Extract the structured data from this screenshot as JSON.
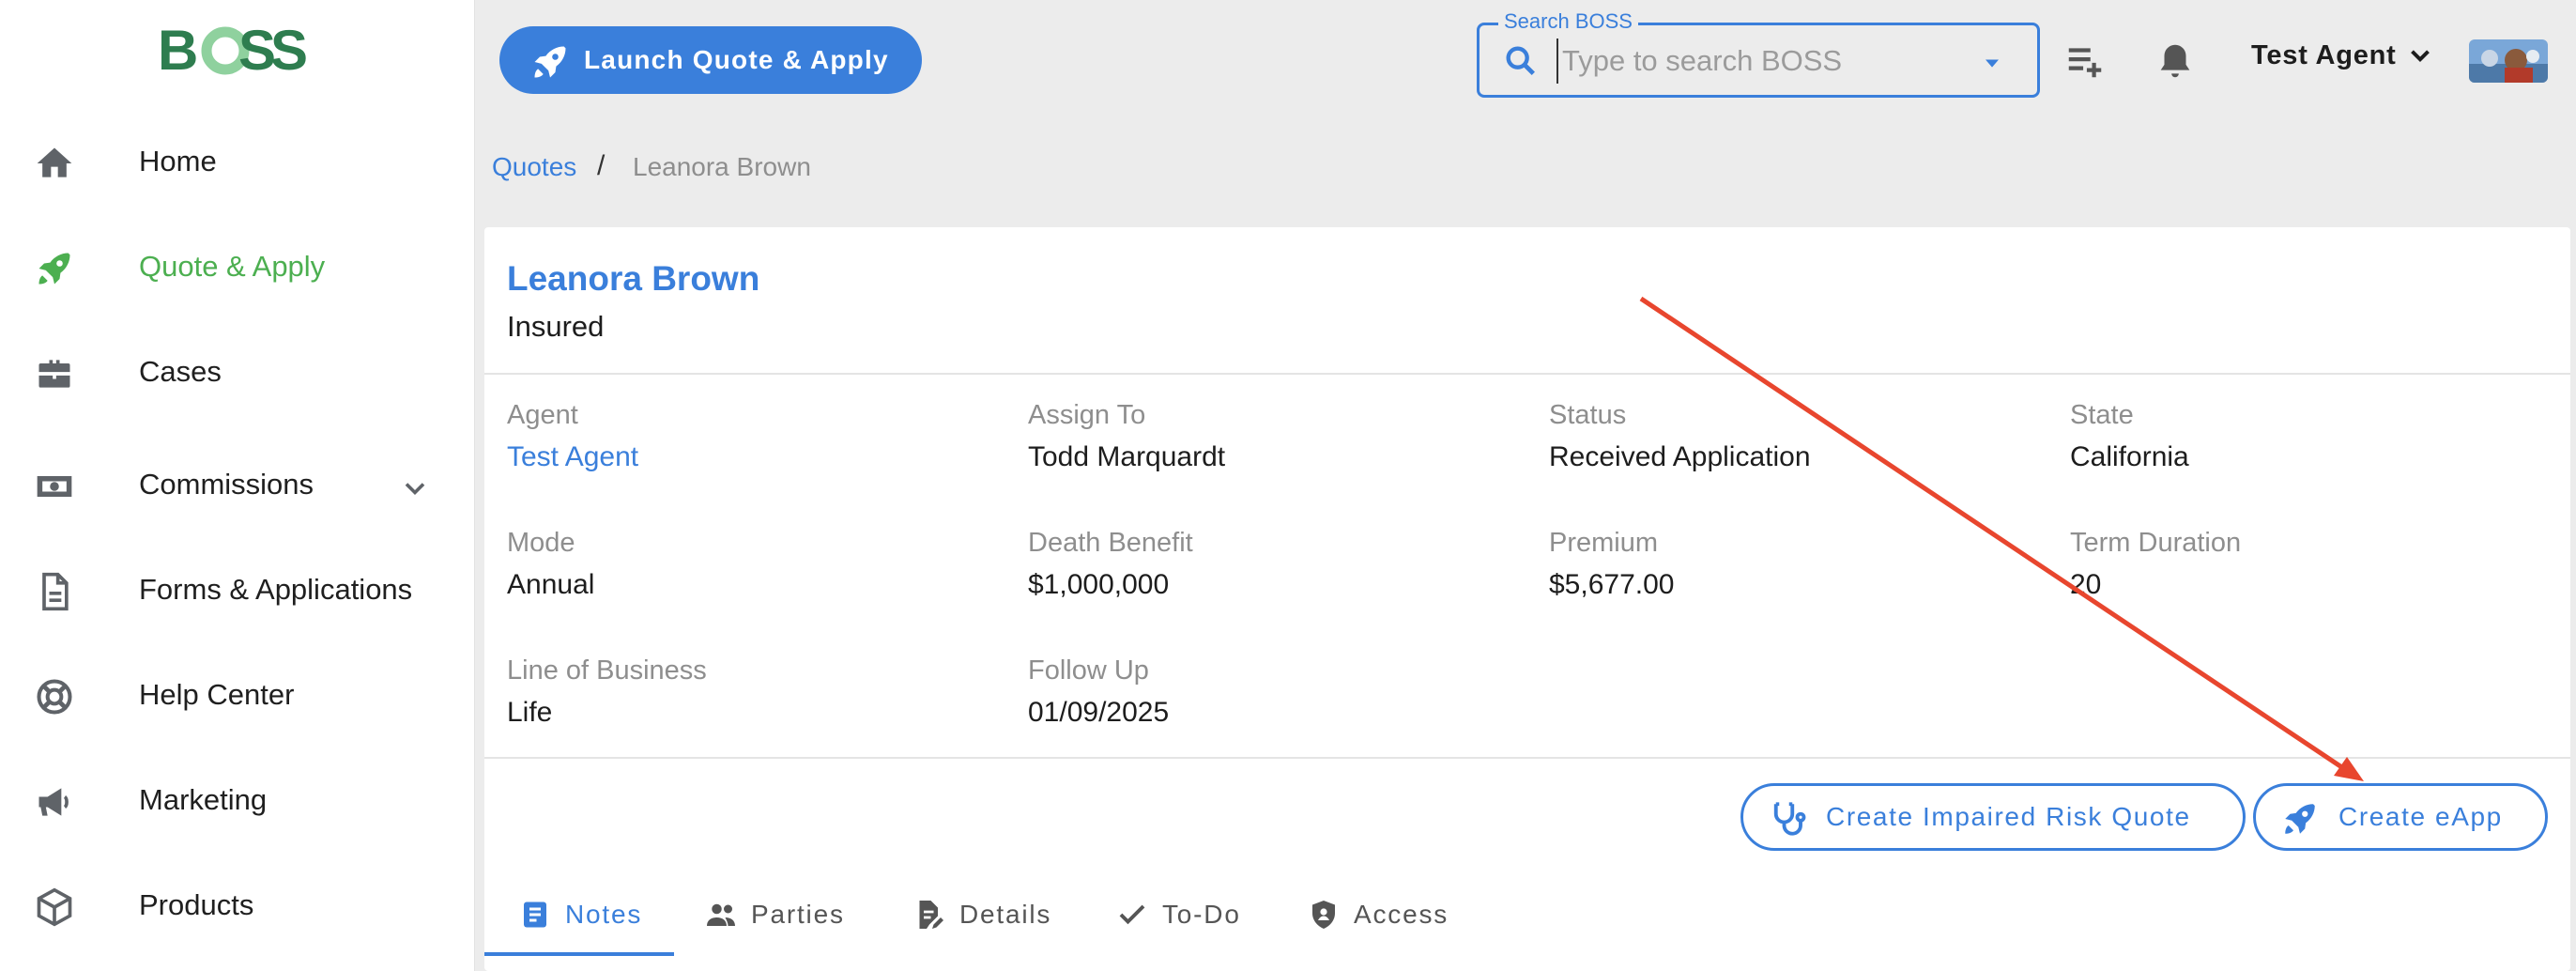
{
  "sidebar": {
    "logo_text": "BOSS",
    "items": [
      {
        "label": "Home",
        "icon": "home-icon"
      },
      {
        "label": "Quote & Apply",
        "icon": "rocket-icon",
        "active": true
      },
      {
        "label": "Cases",
        "icon": "briefcase-icon"
      },
      {
        "label": "Commissions",
        "icon": "money-icon",
        "expandable": true
      },
      {
        "label": "Forms & Applications",
        "icon": "document-icon"
      },
      {
        "label": "Help Center",
        "icon": "lifebuoy-icon"
      },
      {
        "label": "Marketing",
        "icon": "megaphone-icon"
      },
      {
        "label": "Products",
        "icon": "cube-icon"
      }
    ]
  },
  "header": {
    "launch_label": "Launch Quote & Apply",
    "search": {
      "legend": "Search BOSS",
      "placeholder": "Type to search BOSS",
      "value": ""
    },
    "user_name": "Test Agent"
  },
  "breadcrumb": {
    "parent": "Quotes",
    "separator": "/",
    "current": "Leanora Brown"
  },
  "case": {
    "name": "Leanora Brown",
    "role": "Insured",
    "fields": {
      "agent": {
        "label": "Agent",
        "value": "Test Agent"
      },
      "assign_to": {
        "label": "Assign To",
        "value": "Todd Marquardt"
      },
      "status": {
        "label": "Status",
        "value": "Received Application"
      },
      "state": {
        "label": "State",
        "value": "California"
      },
      "mode": {
        "label": "Mode",
        "value": "Annual"
      },
      "death_benefit": {
        "label": "Death Benefit",
        "value": "$1,000,000"
      },
      "premium": {
        "label": "Premium",
        "value": "$5,677.00"
      },
      "term_duration": {
        "label": "Term Duration",
        "value": "20"
      },
      "line_of_business": {
        "label": "Line of Business",
        "value": "Life"
      },
      "follow_up": {
        "label": "Follow Up",
        "value": "01/09/2025"
      }
    }
  },
  "actions": {
    "impaired_risk_label": "Create Impaired Risk Quote",
    "eapp_label": "Create eApp"
  },
  "tabs": [
    {
      "label": "Notes",
      "icon": "notes-icon",
      "active": true
    },
    {
      "label": "Parties",
      "icon": "people-icon"
    },
    {
      "label": "Details",
      "icon": "edit-document-icon"
    },
    {
      "label": "To-Do",
      "icon": "check-icon"
    },
    {
      "label": "Access",
      "icon": "shield-icon"
    }
  ],
  "colors": {
    "primary": "#3a7fdb",
    "active_nav": "#4caf50",
    "logo_dark": "#2e7d4f",
    "annotation": "#e8462e"
  }
}
